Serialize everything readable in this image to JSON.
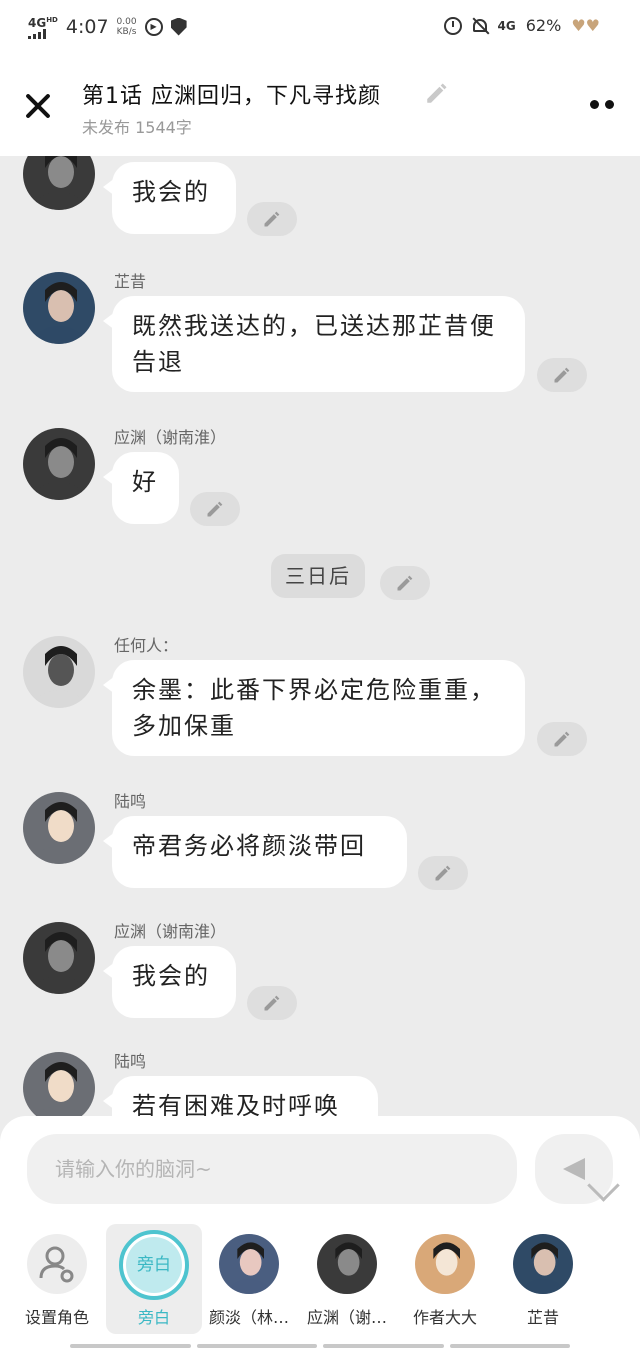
{
  "status_bar": {
    "network": "4G",
    "hd": "HD",
    "time": "4:07",
    "speed_value": "0.00",
    "speed_unit": "KB/s",
    "net_right": "4G",
    "battery": "62%",
    "hearts": "♥♥"
  },
  "header": {
    "title": "第1话  应渊回归，下凡寻找颜",
    "subtitle": "未发布 1544字"
  },
  "messages": [
    {
      "type": "chat",
      "speaker": "应渊（谢南淮）",
      "text": "我会的",
      "avatar_colors": [
        "#3a3a3a",
        "#8a8a8a"
      ]
    },
    {
      "type": "chat",
      "speaker": "芷昔",
      "text": "既然我送达的，已送达那芷昔便告退",
      "avatar_colors": [
        "#2f4a66",
        "#d9bfb0"
      ]
    },
    {
      "type": "chat",
      "speaker": "应渊（谢南淮）",
      "text": "好",
      "avatar_colors": [
        "#3a3a3a",
        "#8a8a8a"
      ]
    },
    {
      "type": "narration",
      "text": "三日后"
    },
    {
      "type": "chat",
      "speaker": "任何人：",
      "text": "余墨：此番下界必定危险重重，多加保重",
      "avatar_colors": [
        "#d9d9d9",
        "#555555"
      ]
    },
    {
      "type": "chat",
      "speaker": "陆鸣",
      "text": "帝君务必将颜淡带回",
      "avatar_colors": [
        "#6b6e74",
        "#f0dcc8"
      ]
    },
    {
      "type": "chat",
      "speaker": "应渊（谢南淮）",
      "text": "我会的",
      "avatar_colors": [
        "#3a3a3a",
        "#8a8a8a"
      ]
    },
    {
      "type": "chat",
      "speaker": "陆鸣",
      "text": "若有困难及时呼唤",
      "avatar_colors": [
        "#6b6e74",
        "#f0dcc8"
      ]
    }
  ],
  "input": {
    "placeholder": "请输入你的脑洞~"
  },
  "roles": [
    {
      "label": "设置角色",
      "icon": "person-gear-icon"
    },
    {
      "label": "旁白",
      "circle_text": "旁白",
      "selected": true
    },
    {
      "label": "颜淡（林…",
      "avatar_colors": [
        "#4a5e80",
        "#e8c8c0"
      ]
    },
    {
      "label": "应渊（谢…",
      "avatar_colors": [
        "#3a3a3a",
        "#8a8a8a"
      ]
    },
    {
      "label": "作者大大",
      "avatar_colors": [
        "#d9a878",
        "#f4e6d6"
      ]
    },
    {
      "label": "芷昔",
      "avatar_colors": [
        "#2f4a66",
        "#d9bfb0"
      ]
    }
  ],
  "colors": {
    "accent": "#4ec4cf",
    "background": "#ececec",
    "bubble": "#ffffff"
  }
}
